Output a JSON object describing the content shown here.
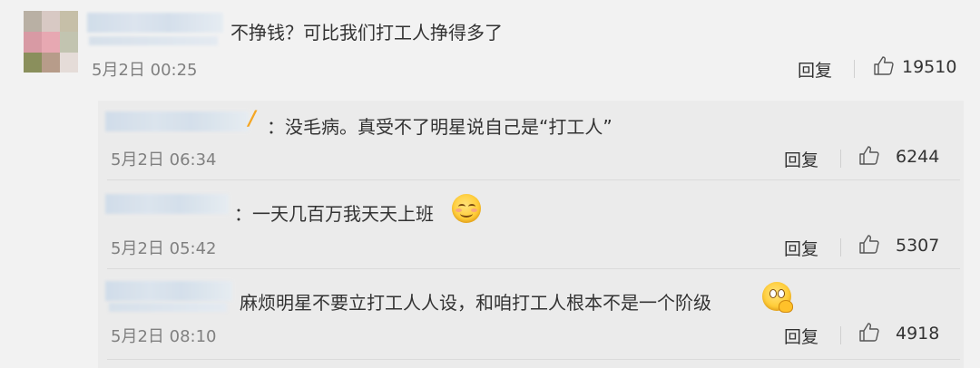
{
  "main_comment": {
    "text": "不挣钱？可比我们打工人挣得多了",
    "date": "5月2日 00:25",
    "reply_label": "回复",
    "likes": "19510"
  },
  "replies": [
    {
      "text": "：没毛病。真受不了明星说自己是“打工人”",
      "date": "5月2日 06:34",
      "reply_label": "回复",
      "likes": "6244",
      "badge": "verified-v-icon"
    },
    {
      "text": "：一天几百万我天天上班",
      "date": "5月2日 05:42",
      "reply_label": "回复",
      "likes": "5307",
      "emoji": "smile-emoji"
    },
    {
      "text": "麻烦明星不要立打工人人设，和咱打工人根本不是一个阶级",
      "date": "5月2日 08:10",
      "reply_label": "回复",
      "likes": "4918",
      "emoji": "thinking-emoji"
    }
  ],
  "colors": {
    "background": "#f2f2f2",
    "reply_panel": "#ebebeb",
    "text": "#333333",
    "date": "#808080",
    "badge": "#f5a623"
  }
}
